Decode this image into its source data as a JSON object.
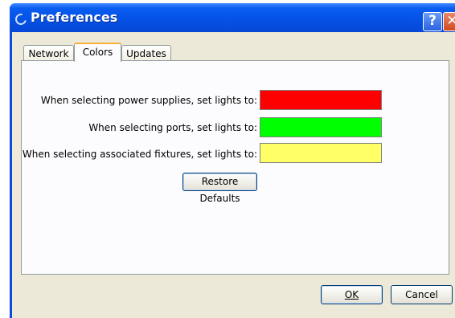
{
  "window": {
    "title": "Preferences",
    "help_glyph": "?",
    "close_glyph": "✕",
    "icon": "refresh-icon"
  },
  "tabs": [
    {
      "label": "Network",
      "active": false
    },
    {
      "label": "Colors",
      "active": true
    },
    {
      "label": "Updates",
      "active": false
    }
  ],
  "colors_panel": {
    "rows": [
      {
        "label": "When selecting power supplies, set lights to:",
        "color": "#ff0000"
      },
      {
        "label": "When selecting ports, set lights to:",
        "color": "#00ff00"
      },
      {
        "label": "When selecting associated fixtures, set lights to:",
        "color": "#ffff66"
      }
    ],
    "restore_label": "Restore Defaults"
  },
  "buttons": {
    "ok_label": "OK",
    "cancel_label": "Cancel"
  }
}
